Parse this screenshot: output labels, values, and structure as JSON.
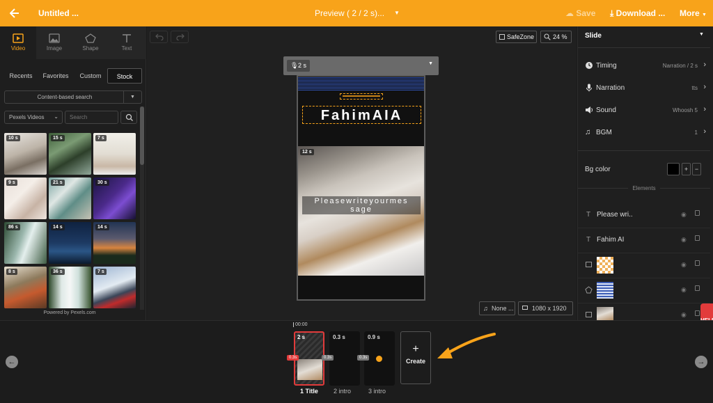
{
  "colors": {
    "accent": "#f8a31a",
    "danger": "#e23b3b"
  },
  "topbar": {
    "back_icon": "arrow-left-icon",
    "title": "Untitled ...",
    "preview": "Preview ( 2 / 2 s)...",
    "save": "Save",
    "download": "Download ...",
    "more": "More"
  },
  "tools": [
    {
      "label": "Video",
      "icon": "video-icon"
    },
    {
      "label": "Image",
      "icon": "image-icon"
    },
    {
      "label": "Shape",
      "icon": "shape-icon"
    },
    {
      "label": "Text",
      "icon": "text-icon"
    }
  ],
  "media_tabs": [
    "Recents",
    "Favorites",
    "Custom",
    "Stock"
  ],
  "search_mode": "Content-based search",
  "source_select": "Pexels Videos",
  "search_placeholder": "Search",
  "thumbs": [
    "10 s",
    "15 s",
    "7 s",
    "9 s",
    "21 s",
    "30 s",
    "86 s",
    "14 s",
    "14 s",
    "8 s",
    "36 s",
    "7 s"
  ],
  "powered_by": "Powered by Pexels.com",
  "canvas": {
    "safezone": "SafeZone",
    "zoom": "24 %",
    "narration_duration": "2 s",
    "heading": "FahimAIA",
    "video_badge": "12 s",
    "caption_line1": "Pleasewriteyourmes",
    "caption_line2": "sage",
    "music": "None ...",
    "resolution": "1080 x 1920 ..."
  },
  "right": {
    "title": "Slide",
    "rows": [
      {
        "label": "Timing",
        "value": "Narration / 2 s"
      },
      {
        "label": "Narration",
        "value": "tts"
      },
      {
        "label": "Sound",
        "value": "Whoosh 5"
      },
      {
        "label": "BGM",
        "value": "1"
      }
    ],
    "bg_color_label": "Bg color",
    "elements_label": "Elements",
    "elements": [
      {
        "type": "T",
        "name": "Please wri.."
      },
      {
        "type": "T",
        "name": "Fahim AI"
      },
      {
        "type": "image",
        "name": ""
      },
      {
        "type": "shape",
        "name": ""
      },
      {
        "type": "video",
        "name": ""
      }
    ],
    "help": "HELP"
  },
  "timeline": {
    "time": "00:00",
    "slides": [
      {
        "duration": "2 s",
        "label": "1 Title",
        "transition": "0.3s"
      },
      {
        "duration": "0.3 s",
        "label": "2 intro",
        "transition": "0.3s"
      },
      {
        "duration": "0.9 s",
        "label": "3 intro",
        "transition": "0.3s"
      }
    ],
    "create_label": "Create"
  }
}
